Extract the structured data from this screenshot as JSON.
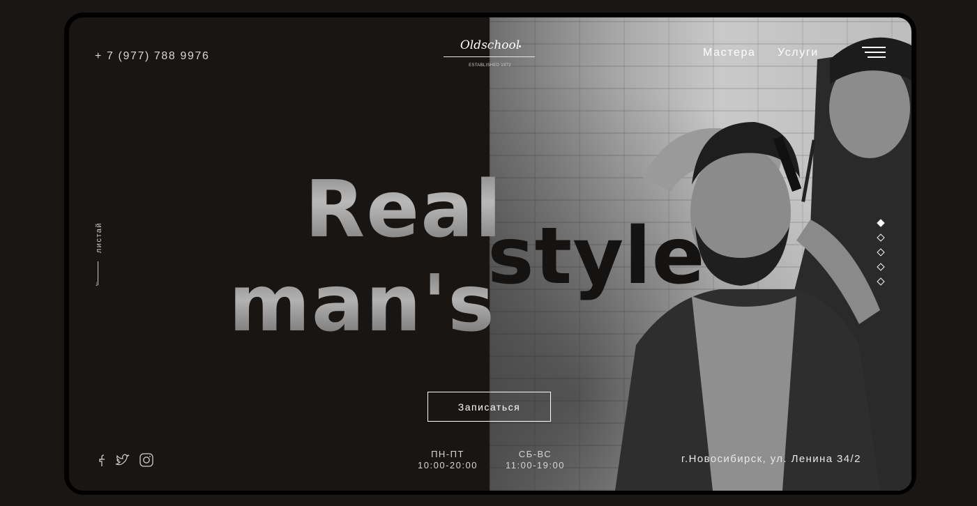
{
  "header": {
    "phone": "+ 7 (977) 788 9976",
    "logo_name": "Oldschool",
    "logo_tagline": "ESTABLISHED 1972",
    "nav": [
      {
        "label": "Мастера"
      },
      {
        "label": "Услуги"
      }
    ]
  },
  "scroll_hint": {
    "label": "листай"
  },
  "hero": {
    "headline_word1": "Real",
    "headline_word2": "man's",
    "headline_word3": "style",
    "cta_label": "Записаться"
  },
  "slider": {
    "total": 5,
    "active_index": 0
  },
  "footer": {
    "socials": [
      {
        "icon": "facebook-icon"
      },
      {
        "icon": "twitter-icon"
      },
      {
        "icon": "instagram-icon"
      }
    ],
    "hours": [
      {
        "days": "ПН-ПТ",
        "time": "10:00-20:00"
      },
      {
        "days": "СБ-ВС",
        "time": "11:00-19:00"
      }
    ],
    "address": "г.Новосибирск, ул. Ленина 34/2"
  },
  "colors": {
    "background": "#181513",
    "frame": "#000000",
    "accent": "#ffffff"
  }
}
